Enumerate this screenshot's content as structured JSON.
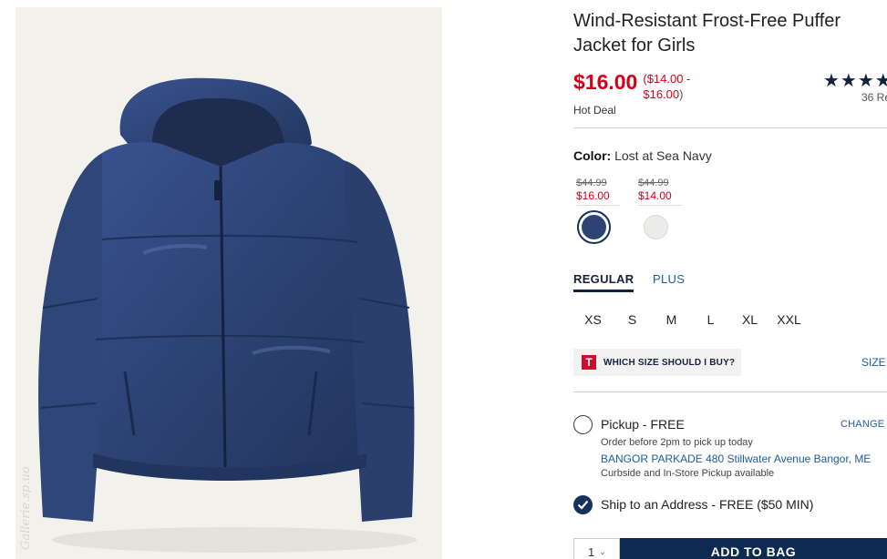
{
  "product": {
    "title": "Wind-Resistant Frost-Free Puffer Jacket for Girls",
    "image_alt_icon": "jacket-image",
    "watermark": "Gallerie.sp.uo"
  },
  "price": {
    "current": "$16.00",
    "range_line1": "($14.00 -",
    "range_line2": "$16.00",
    "range_close": ")",
    "badge": "Hot Deal"
  },
  "rating": {
    "stars": "★★★★",
    "stars_value": 4,
    "reviews": "36 Re"
  },
  "color": {
    "label": "Color:",
    "value": "Lost at Sea Navy",
    "swatches": [
      {
        "old_price": "$44.99",
        "new_price": "$16.00",
        "color": "#2d4374",
        "selected": true
      },
      {
        "old_price": "$44.99",
        "new_price": "$14.00",
        "color": "#ececea",
        "selected": false
      }
    ]
  },
  "fit_tabs": [
    {
      "label": "REGULAR",
      "active": true
    },
    {
      "label": "PLUS",
      "active": false
    }
  ],
  "sizes": [
    "XS",
    "S",
    "M",
    "L",
    "XL",
    "XXL"
  ],
  "size_help": {
    "logo": "T",
    "label": "WHICH SIZE SHOULD I BUY?",
    "chart_link": "SIZE"
  },
  "fulfillment": {
    "pickup_label": "Pickup - FREE",
    "change_store": "CHANGE S",
    "order_before": "Order before 2pm to pick up today",
    "store_address": "BANGOR PARKADE 480 Stillwater Avenue  Bangor, ME",
    "curbside": "Curbside and In-Store Pickup available",
    "ship_label": "Ship to an Address - FREE ($50 MIN)"
  },
  "cart": {
    "qty": "1",
    "add_label": "ADD TO BAG"
  },
  "colors": {
    "sale_red": "#d0021b",
    "navy": "#14213d",
    "link_blue": "#1d5ea0",
    "button_navy": "#0d2a52",
    "jacket_navy": "#2d4374"
  }
}
